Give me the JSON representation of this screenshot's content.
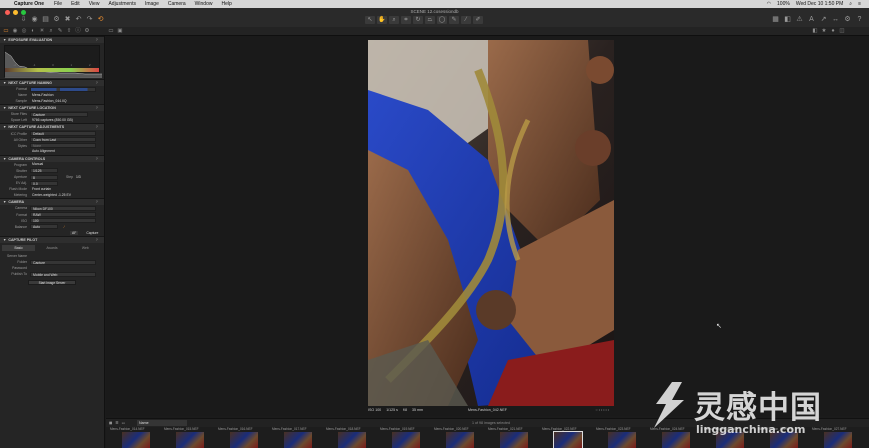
{
  "menubar": {
    "app_name": "Capture One",
    "items": [
      "File",
      "Edit",
      "View",
      "Adjustments",
      "Image",
      "Camera",
      "Window",
      "Help"
    ],
    "battery": "100%",
    "clock": "Wed Dec 10  1:50 PM"
  },
  "toolbar": {
    "document_title": "SCENE 12.cosessiondb"
  },
  "panel": {
    "exposure": {
      "title": "EXPOSURE EVALUATION",
      "ticks": [
        "-2",
        "-1",
        "0",
        "1",
        "2"
      ]
    },
    "naming": {
      "title": "NEXT CAPTURE NAMING",
      "format_label": "Format",
      "name_label": "Name",
      "name_value": "Mens-Fashion",
      "sample_label": "Sample",
      "sample_value": "Mens-Fashion_044.IIQ"
    },
    "location": {
      "title": "NEXT CAPTURE LOCATION",
      "store_label": "Store Files",
      "store_value": "Capture",
      "space_label": "Space Left",
      "space_value": "9766 captures (850.00 GB)"
    },
    "adjustments": {
      "title": "NEXT CAPTURE ADJUSTMENTS",
      "icc_label": "ICC Profile",
      "icc_value": "Default",
      "all_other_label": "All Other",
      "all_other_value": "Copy from Last",
      "styles_label": "Styles",
      "styles_value": "None",
      "auto_alignment": "Auto Alignment"
    },
    "camera_controls": {
      "title": "CAMERA CONTROLS",
      "program_label": "Program",
      "program_value": "Manual",
      "shutter_label": "Shutter",
      "shutter_value": "1/125",
      "aperture_label": "Aperture",
      "aperture_value": "8",
      "ev_label": "EV Adj.",
      "ev_value": "0.0",
      "step_label": "Step",
      "step_value": "1/3",
      "flash_label": "Flash Mode",
      "flash_value": "Front curtain",
      "metering_label": "Metering",
      "metering_value": "Center-weighted  -1.25 EV"
    },
    "camera": {
      "title": "CAMERA",
      "camera_label": "Camera",
      "camera_value": "Nikon DF100",
      "format_label": "Format",
      "format_value": "RAW",
      "iso_label": "ISO",
      "iso_value": "100",
      "balance_label": "Balance",
      "balance_value": "Auto",
      "af_label": "AF",
      "capture_label": "Capture"
    },
    "pilot": {
      "title": "CAPTURE PILOT",
      "tabs": [
        "Basic",
        "Awards",
        "Web"
      ],
      "server_label": "Server Name",
      "folder_label": "Folder",
      "folder_value": "Capture",
      "password_label": "Password",
      "publish_label": "Publish To",
      "publish_value": "Mobile and Web",
      "start_button": "Start Image Server"
    }
  },
  "viewer": {
    "iso": "ISO 100",
    "shutter": "1/125 s",
    "aperture": "f/8",
    "focal": "35 mm",
    "filename": "Mens-Fashion_042.NEF"
  },
  "browser": {
    "sort": "Name",
    "count": "1 of 98 images selected"
  },
  "filmstrip": [
    "Mens-Fashion_014.NEF",
    "Mens-Fashion_015.NEF",
    "Mens-Fashion_016.NEF",
    "Mens-Fashion_017.NEF",
    "Mens-Fashion_018.NEF",
    "Mens-Fashion_019.NEF",
    "Mens-Fashion_020.NEF",
    "Mens-Fashion_021.NEF",
    "Mens-Fashion_022.NEF",
    "Mens-Fashion_023.NEF",
    "Mens-Fashion_024.NEF",
    "Mens-Fashion_025.NEF",
    "Mens-Fashion_026.NEF",
    "Mens-Fashion_027.NEF"
  ],
  "watermark": {
    "title": "灵感中国",
    "url": "lingganchina.com"
  },
  "colors": {
    "accent": "#e48a2f",
    "panel": "#252525",
    "viewer": "#1a1a1a"
  }
}
